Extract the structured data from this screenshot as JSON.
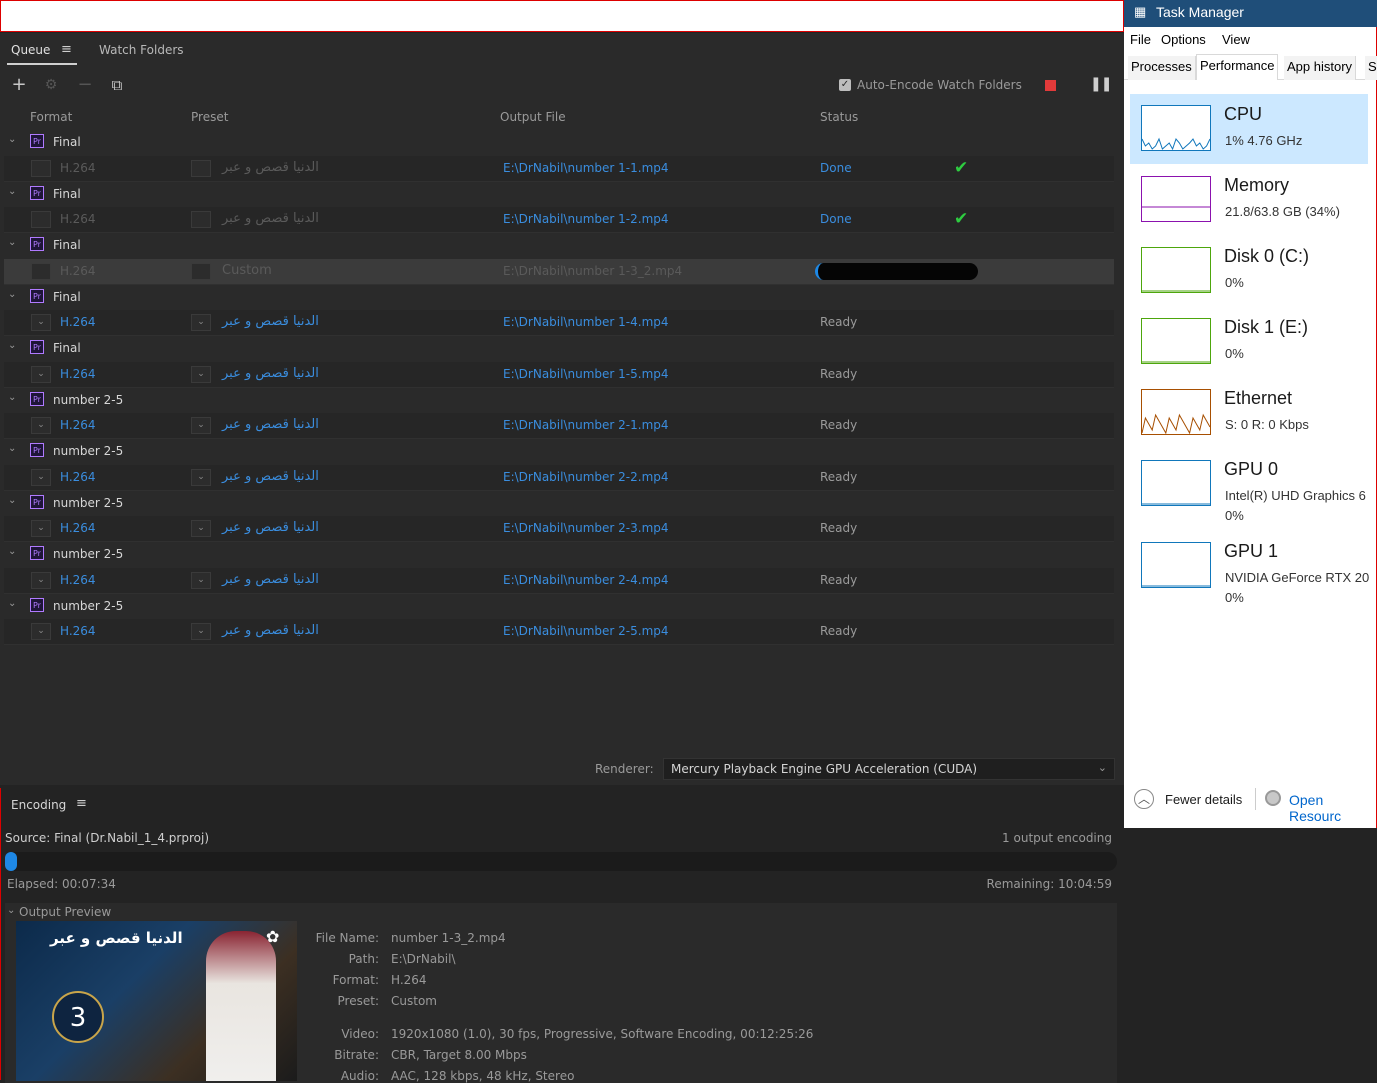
{
  "queue": {
    "tabs": [
      "Queue",
      "Watch Folders"
    ],
    "auto_encode_label": "Auto-Encode Watch Folders",
    "columns": {
      "format": "Format",
      "preset": "Preset",
      "output": "Output File",
      "status": "Status"
    },
    "rows": [
      {
        "type": "group",
        "name": "Final"
      },
      {
        "type": "item",
        "format": "H.264",
        "preset": "الدنيا قصص و عبر",
        "output": "E:\\DrNabil\\number 1-1.mp4",
        "status": "Done",
        "state": "done"
      },
      {
        "type": "group",
        "name": "Final"
      },
      {
        "type": "item",
        "format": "H.264",
        "preset": "الدنيا قصص و عبر",
        "output": "E:\\DrNabil\\number 1-2.mp4",
        "status": "Done",
        "state": "done"
      },
      {
        "type": "group",
        "name": "Final"
      },
      {
        "type": "item",
        "format": "H.264",
        "preset": "Custom",
        "output": "E:\\DrNabil\\number 1-3_2.mp4",
        "status": "",
        "state": "encoding",
        "progress": 0.01
      },
      {
        "type": "group",
        "name": "Final"
      },
      {
        "type": "item",
        "format": "H.264",
        "preset": "الدنيا قصص و عبر",
        "output": "E:\\DrNabil\\number 1-4.mp4",
        "status": "Ready",
        "state": "ready"
      },
      {
        "type": "group",
        "name": "Final"
      },
      {
        "type": "item",
        "format": "H.264",
        "preset": "الدنيا قصص و عبر",
        "output": "E:\\DrNabil\\number 1-5.mp4",
        "status": "Ready",
        "state": "ready"
      },
      {
        "type": "group",
        "name": "number 2-5"
      },
      {
        "type": "item",
        "format": "H.264",
        "preset": "الدنيا قصص و عبر",
        "output": "E:\\DrNabil\\number 2-1.mp4",
        "status": "Ready",
        "state": "ready"
      },
      {
        "type": "group",
        "name": "number 2-5"
      },
      {
        "type": "item",
        "format": "H.264",
        "preset": "الدنيا قصص و عبر",
        "output": "E:\\DrNabil\\number 2-2.mp4",
        "status": "Ready",
        "state": "ready"
      },
      {
        "type": "group",
        "name": "number 2-5"
      },
      {
        "type": "item",
        "format": "H.264",
        "preset": "الدنيا قصص و عبر",
        "output": "E:\\DrNabil\\number 2-3.mp4",
        "status": "Ready",
        "state": "ready"
      },
      {
        "type": "group",
        "name": "number 2-5"
      },
      {
        "type": "item",
        "format": "H.264",
        "preset": "الدنيا قصص و عبر",
        "output": "E:\\DrNabil\\number 2-4.mp4",
        "status": "Ready",
        "state": "ready"
      },
      {
        "type": "group",
        "name": "number 2-5"
      },
      {
        "type": "item",
        "format": "H.264",
        "preset": "الدنيا قصص و عبر",
        "output": "E:\\DrNabil\\number 2-5.mp4",
        "status": "Ready",
        "state": "ready"
      }
    ],
    "renderer_label": "Renderer:",
    "renderer_value": "Mercury Playback Engine GPU Acceleration (CUDA)"
  },
  "encoding": {
    "title": "Encoding",
    "source": "Source: Final (Dr.Nabil_1_4.prproj)",
    "outputs": "1 output encoding",
    "progress": 0.01,
    "elapsed": "Elapsed: 00:07:34",
    "remaining": "Remaining: 10:04:59",
    "preview_label": "Output Preview",
    "thumb_title": "الدنيا قصص و عبر",
    "thumb_number": "3",
    "meta": [
      {
        "label": "File Name:",
        "value": "number 1-3_2.mp4"
      },
      {
        "label": "Path:",
        "value": "E:\\DrNabil\\"
      },
      {
        "label": "Format:",
        "value": "H.264"
      },
      {
        "label": "Preset:",
        "value": "Custom"
      },
      {
        "label": "Video:",
        "value": "1920x1080 (1.0), 30 fps, Progressive, Software Encoding, 00:12:25:26"
      },
      {
        "label": "Bitrate:",
        "value": "CBR, Target 8.00 Mbps"
      },
      {
        "label": "Audio:",
        "value": "AAC, 128 kbps, 48 kHz, Stereo"
      }
    ]
  },
  "taskmanager": {
    "title": "Task Manager",
    "menu": [
      "File",
      "Options",
      "View"
    ],
    "tabs": [
      "Processes",
      "Performance",
      "App history",
      "S"
    ],
    "items": [
      {
        "name": "CPU",
        "lines": [
          "1%  4.76 GHz"
        ],
        "color": "#1177bb",
        "selected": true
      },
      {
        "name": "Memory",
        "lines": [
          "21.8/63.8 GB (34%)"
        ],
        "color": "#8b12ae"
      },
      {
        "name": "Disk 0 (C:)",
        "lines": [
          "0%"
        ],
        "color": "#4da60c"
      },
      {
        "name": "Disk 1 (E:)",
        "lines": [
          "0%"
        ],
        "color": "#4da60c"
      },
      {
        "name": "Ethernet",
        "lines": [
          "S: 0  R: 0 Kbps"
        ],
        "color": "#a74f01"
      },
      {
        "name": "GPU 0",
        "lines": [
          "Intel(R) UHD Graphics 6",
          "0%"
        ],
        "color": "#1177bb"
      },
      {
        "name": "GPU 1",
        "lines": [
          "NVIDIA GeForce RTX 20",
          "0%"
        ],
        "color": "#1177bb"
      }
    ],
    "fewer_details": "Fewer details",
    "open_resource": "Open Resourc"
  }
}
